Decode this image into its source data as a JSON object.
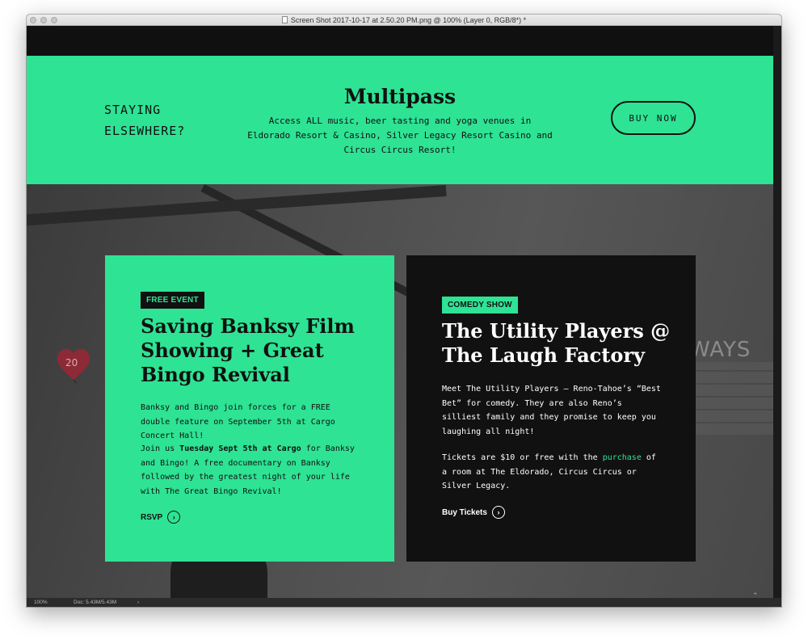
{
  "window": {
    "title": "Screen Shot 2017-10-17 at 2.50.20 PM.png @ 100% (Layer 0, RGB/8*) *"
  },
  "promo": {
    "staying_text": "STAYING ELSEWHERE?",
    "title": "Multipass",
    "description": "Access ALL music, beer tasting and yoga venues in Eldorado Resort & Casino, Silver Legacy Resort Casino and Circus Circus Resort!",
    "buy_label": "BUY NOW",
    "accent_color": "#2ee394"
  },
  "background": {
    "heart_text": "20",
    "wall_text": "WAYS"
  },
  "cards": [
    {
      "tag": "FREE EVENT",
      "title": "Saving Banksy Film Showing + Great Bingo Revival",
      "p1": "Banksy and Bingo join forces for a FREE double feature on September 5th at Cargo Concert Hall!",
      "p2_pre": "Join us ",
      "p2_strong": "Tuesday Sept 5th at Cargo",
      "p2_post": " for Banksy and Bingo! A free documentary on Banksy followed by the greatest night of your life with The Great Bingo Revival!",
      "link_label": "RSVP"
    },
    {
      "tag": "COMEDY SHOW",
      "title": "The Utility Players @ The Laugh Factory",
      "p1": "Meet The Utility Players – Reno-Tahoe’s “Best Bet” for comedy. They are also Reno’s silliest family and they promise to keep you laughing all night!",
      "p2_pre": "Tickets are $10 or free with the ",
      "p2_link": "purchase",
      "p2_post": " of a room at The Eldorado, Circus Circus or Silver Legacy.",
      "link_label": "Buy Tickets"
    }
  ],
  "statusbar": {
    "zoom": "100%",
    "doc": "Doc: 5.43M/5.43M"
  }
}
